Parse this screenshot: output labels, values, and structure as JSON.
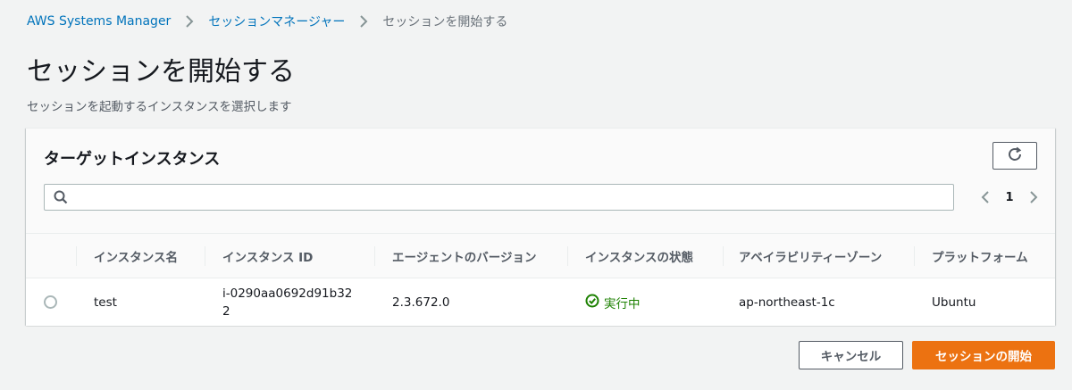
{
  "breadcrumb": {
    "items": [
      "AWS Systems Manager",
      "セッションマネージャー"
    ],
    "current": "セッションを開始する"
  },
  "page": {
    "title": "セッションを開始する",
    "description": "セッションを起動するインスタンスを選択します"
  },
  "panel": {
    "title": "ターゲットインスタンス",
    "search_placeholder": "",
    "page_number": "1"
  },
  "table": {
    "columns": [
      "インスタンス名",
      "インスタンス ID",
      "エージェントのバージョン",
      "インスタンスの状態",
      "アベイラビリティーゾーン",
      "プラットフォーム"
    ],
    "rows": [
      {
        "name": "test",
        "instance_id": "i-0290aa0692d91b322",
        "agent_version": "2.3.672.0",
        "state": "実行中",
        "zone": "ap-northeast-1c",
        "platform": "Ubuntu"
      }
    ]
  },
  "buttons": {
    "cancel": "キャンセル",
    "start": "セッションの開始"
  },
  "colors": {
    "link": "#0073bb",
    "primary": "#ec7211",
    "success": "#1d8102"
  },
  "icons": {
    "breadcrumb_separator": "chevron-right-icon",
    "refresh": "refresh-icon",
    "search": "search-icon",
    "pager_prev": "chevron-left-icon",
    "pager_next": "chevron-right-icon",
    "status": "check-circle-icon"
  }
}
